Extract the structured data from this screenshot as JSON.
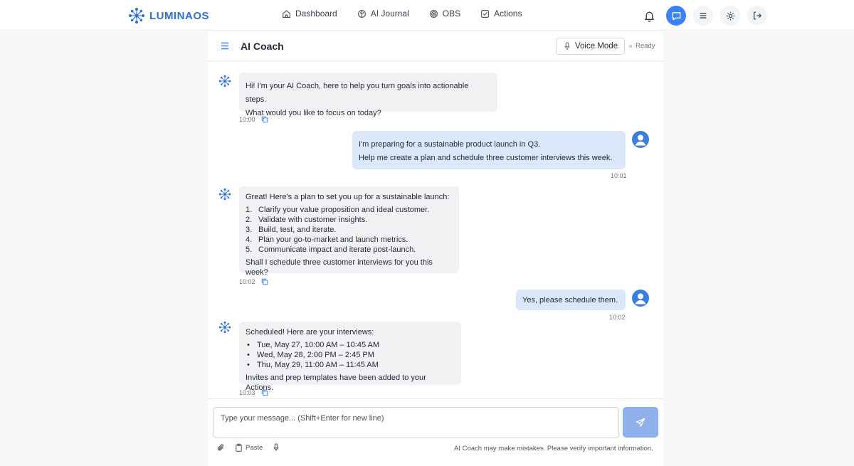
{
  "brand": {
    "name": "LUMINAOS",
    "accent": "#2f6fd6"
  },
  "nav": [
    {
      "label": "Dashboard",
      "icon": "home-icon"
    },
    {
      "label": "AI Journal",
      "icon": "brain-icon"
    },
    {
      "label": "OBS",
      "icon": "target-icon"
    },
    {
      "label": "Actions",
      "icon": "checkbox-icon"
    }
  ],
  "top_actions": [
    "bell-icon",
    "chat-icon",
    "list-icon",
    "gear-icon",
    "logout-icon"
  ],
  "chat": {
    "title": "AI Coach",
    "voice_mode_label": "Voice Mode",
    "status": "Ready",
    "messages": [
      {
        "role": "assistant",
        "lines": [
          "Hi! I'm your AI Coach, here to help you turn goals into actionable steps.",
          "What would you like to focus on today?"
        ],
        "time": "10:00"
      },
      {
        "role": "user",
        "lines": [
          "I'm preparing for a sustainable product launch in Q3.",
          "Help me create a plan and schedule three customer interviews this week."
        ],
        "time": "10:01"
      },
      {
        "role": "assistant",
        "intro": "Great! Here's a plan to set you up for a sustainable launch:",
        "steps": [
          {
            "n": "1.",
            "text": "Clarify your value proposition and ideal customer."
          },
          {
            "n": "2.",
            "text": "Validate with customer insights."
          },
          {
            "n": "3.",
            "text": "Build, test, and iterate."
          },
          {
            "n": "4.",
            "text": "Plan your go-to-market and launch metrics."
          },
          {
            "n": "5.",
            "text": "Communicate impact and iterate post-launch."
          }
        ],
        "outro": "Shall I schedule three customer interviews for you this week?",
        "time": "10:02"
      },
      {
        "role": "user",
        "lines": [
          "Yes, please schedule them."
        ],
        "time": "10:02"
      },
      {
        "role": "assistant",
        "intro": "Scheduled! Here are your interviews:",
        "bullets": [
          "Tue, May 27, 10:00 AM – 10:45 AM",
          "Wed, May 28, 2:00 PM – 2:45 PM",
          "Thu, May 29, 11:00 AM – 11:45 AM"
        ],
        "outro": "Invites and prep templates have been added to your Actions.",
        "time": "10:03"
      }
    ]
  },
  "composer": {
    "placeholder": "Type your message... (Shift+Enter for new line)",
    "paste_label": "Paste",
    "disclaimer": "AI Coach may make mistakes. Please verify important information."
  },
  "colors": {
    "user_bubble": "#dbe8fb",
    "bot_bubble": "#f1f1f3",
    "send_button": "#8fb0ea",
    "active_icon": "#3b82f6"
  }
}
